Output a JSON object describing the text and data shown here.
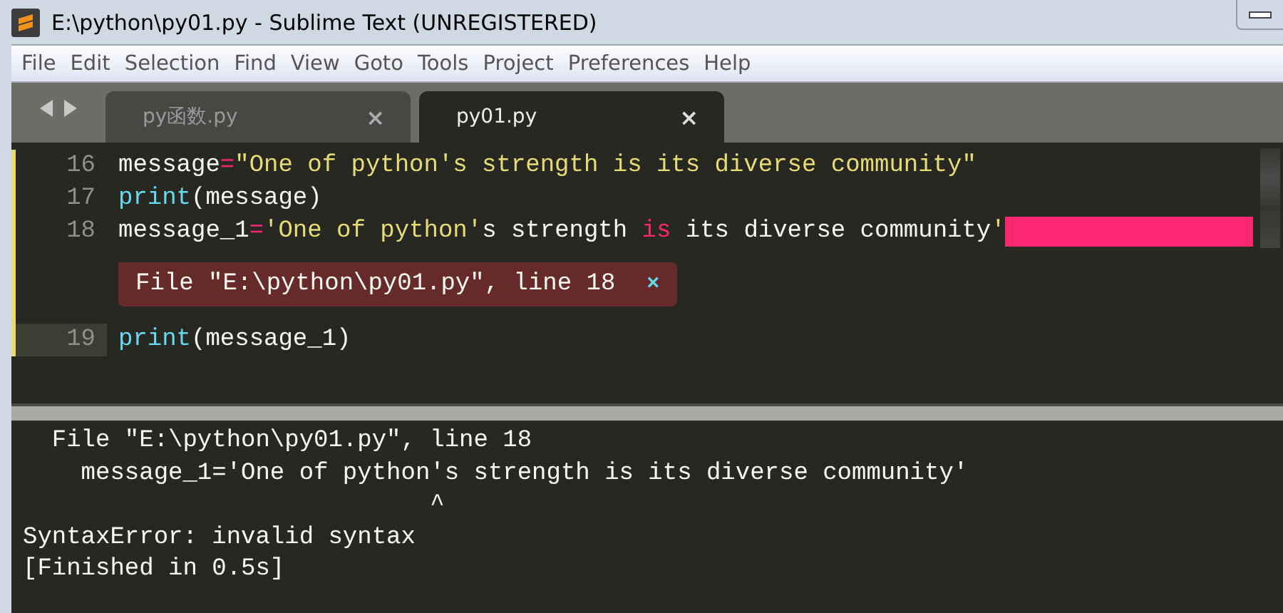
{
  "window": {
    "title": "E:\\python\\py01.py - Sublime Text (UNREGISTERED)"
  },
  "menu": [
    "File",
    "Edit",
    "Selection",
    "Find",
    "View",
    "Goto",
    "Tools",
    "Project",
    "Preferences",
    "Help"
  ],
  "tabs": [
    {
      "label": "py函数.py",
      "close": "×",
      "selected": false
    },
    {
      "label": "py01.py",
      "close": "×",
      "selected": true
    }
  ],
  "editor": {
    "lines": [
      {
        "number": "16",
        "current": false,
        "modified": true,
        "error_marker": false,
        "tokens": [
          {
            "text": "message",
            "kind": "plain"
          },
          {
            "text": "=",
            "kind": "op"
          },
          {
            "text": "\"One of python's strength is its diverse community\"",
            "kind": "string"
          }
        ]
      },
      {
        "number": "17",
        "current": false,
        "modified": true,
        "error_marker": false,
        "tokens": [
          {
            "text": "print",
            "kind": "builtin"
          },
          {
            "text": "(message)",
            "kind": "plain"
          }
        ]
      },
      {
        "number": "18",
        "current": false,
        "modified": true,
        "error_marker": true,
        "tokens": [
          {
            "text": "message_1",
            "kind": "plain"
          },
          {
            "text": "=",
            "kind": "op"
          },
          {
            "text": "'One of python'",
            "kind": "string"
          },
          {
            "text": "s strength ",
            "kind": "plain"
          },
          {
            "text": "is",
            "kind": "op"
          },
          {
            "text": " its diverse community",
            "kind": "plain"
          },
          {
            "text": "'",
            "kind": "string"
          }
        ],
        "phantom": {
          "text": "File \"E:\\python\\py01.py\", line 18",
          "close": "×"
        }
      },
      {
        "number": "19",
        "current": true,
        "modified": true,
        "error_marker": false,
        "tokens": [
          {
            "text": "print",
            "kind": "builtin"
          },
          {
            "text": "(message_1)",
            "kind": "plain"
          }
        ]
      }
    ]
  },
  "output": [
    "  File \"E:\\python\\py01.py\", line 18",
    "    message_1='One of python's strength is its diverse community'",
    "                            ^",
    "SyntaxError: invalid syntax",
    "[Finished in 0.5s]"
  ]
}
